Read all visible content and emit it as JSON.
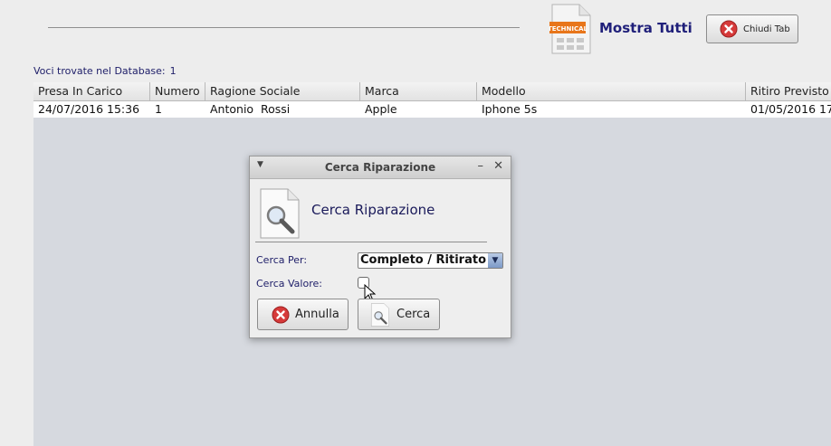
{
  "toolbar": {
    "show_all_label": "Mostra Tutti",
    "show_all_icon_badge": "TECHNICAL",
    "close_tab_label": "Chiudi Tab"
  },
  "db_count": {
    "label": "Voci trovate nel Database:",
    "value": "1"
  },
  "table": {
    "columns": [
      "Presa In Carico",
      "Numero",
      "Ragione Sociale",
      "Marca",
      "Modello",
      "Ritiro Previsto"
    ],
    "rows": [
      [
        "24/07/2016 15:36",
        "1",
        "Antonio  Rossi",
        "Apple",
        "Iphone 5s",
        "01/05/2016 17:"
      ]
    ]
  },
  "dialog": {
    "window_title": "Cerca Riparazione",
    "heading": "Cerca Riparazione",
    "cerca_per_label": "Cerca Per:",
    "cerca_per_value": "Completo / Ritirato",
    "cerca_valore_label": "Cerca Valore:",
    "annulla_label": "Annulla",
    "cerca_label": "Cerca"
  },
  "colors": {
    "accent_text": "#20207a",
    "table_bg": "#d6d9df",
    "badge_orange": "#e8761b",
    "close_red": "#d63a3a"
  },
  "icons": [
    "document-technical-icon",
    "close-circle-icon",
    "magnifier-document-icon",
    "dropdown-arrow-icon",
    "mouse-pointer-icon"
  ]
}
